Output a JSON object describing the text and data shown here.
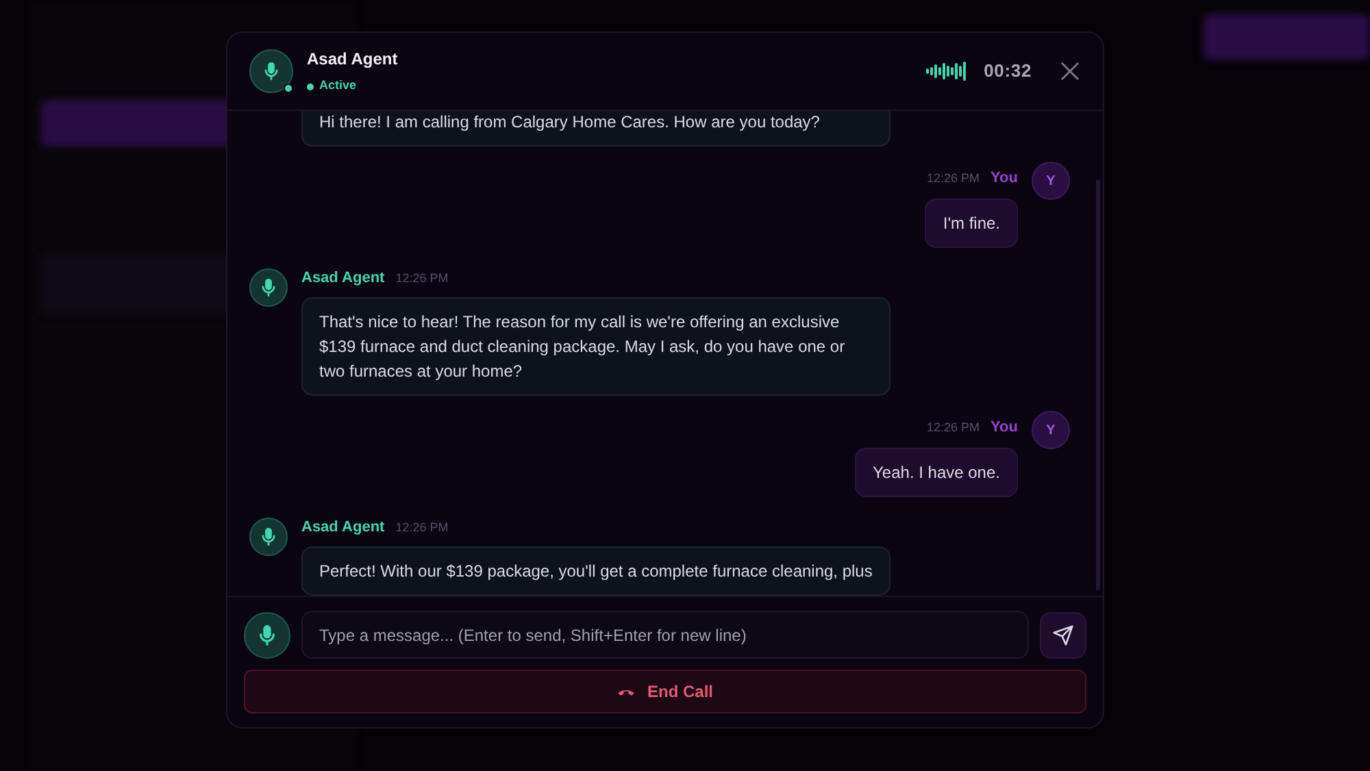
{
  "call": {
    "agent_name": "Asad Agent",
    "status": "Active",
    "active": true,
    "timer": "00:32"
  },
  "messages": [
    {
      "kind": "agent",
      "text": "Hi there! I am calling from Calgary Home Cares. How are you today?"
    },
    {
      "kind": "user",
      "sender": "You",
      "time": "12:26 PM",
      "avatar": "Y",
      "text": "I'm fine."
    },
    {
      "kind": "agent",
      "sender": "Asad Agent",
      "time": "12:26 PM",
      "text": "That's nice to hear! The reason for my call is we're offering an exclusive $139 furnace and duct cleaning package. May I ask, do you have one or two furnaces at your home?"
    },
    {
      "kind": "user",
      "sender": "You",
      "time": "12:26 PM",
      "avatar": "Y",
      "text": "Yeah. I have one."
    },
    {
      "kind": "agent",
      "sender": "Asad Agent",
      "time": "12:26 PM",
      "text": "Perfect! With our $139 package, you'll get a complete furnace cleaning, plus"
    }
  ],
  "composer": {
    "placeholder": "Type a message... (Enter to send, Shift+Enter for new line)"
  },
  "end_call": {
    "label": "End Call"
  }
}
